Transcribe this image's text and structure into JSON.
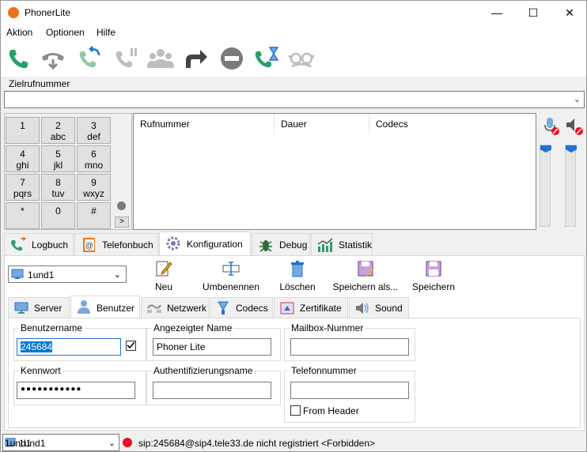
{
  "window": {
    "title": "PhonerLite",
    "minimize": "—",
    "maximize": "☐",
    "close": "✕"
  },
  "menu": [
    "Aktion",
    "Optionen",
    "Hilfe"
  ],
  "toolbar": {
    "icons": [
      "call-icon",
      "hangup-icon",
      "transfer-call-icon",
      "hold-icon",
      "conference-icon",
      "forward-icon",
      "do-not-disturb-icon",
      "call-waiting-icon",
      "incognito-icon"
    ]
  },
  "dial": {
    "label": "Zielrufnummer",
    "value": "",
    "dropdown_arrow": "⌄"
  },
  "keypad": {
    "keys": [
      {
        "digit": "1",
        "letters": ""
      },
      {
        "digit": "2",
        "letters": "abc"
      },
      {
        "digit": "3",
        "letters": "def"
      },
      {
        "digit": "4",
        "letters": "ghi"
      },
      {
        "digit": "5",
        "letters": "jkl"
      },
      {
        "digit": "6",
        "letters": "mno"
      },
      {
        "digit": "7",
        "letters": "pqrs"
      },
      {
        "digit": "8",
        "letters": "tuv"
      },
      {
        "digit": "9",
        "letters": "wxyz"
      },
      {
        "digit": "*",
        "letters": ""
      },
      {
        "digit": "0",
        "letters": ""
      },
      {
        "digit": "#",
        "letters": ""
      }
    ],
    "more": ">"
  },
  "calllist": {
    "columns": [
      "Rufnummer",
      "Dauer",
      "Codecs"
    ]
  },
  "tabs": [
    "Logbuch",
    "Telefonbuch",
    "Konfiguration",
    "Debug",
    "Statistik"
  ],
  "config": {
    "profile": "1und1",
    "profile_arrow": "⌄",
    "buttons": [
      "Neu",
      "Umbenennen",
      "Löschen",
      "Speichern als...",
      "Speichern"
    ]
  },
  "subtabs": [
    "Server",
    "Benutzer",
    "Netzwerk",
    "Codecs",
    "Zertifikate",
    "Sound"
  ],
  "user": {
    "username_label": "Benutzername",
    "username": "245684",
    "display_label": "Angezeigter Name",
    "display_name": "Phoner Lite",
    "mailbox_label": "Mailbox-Nummer",
    "mailbox": "",
    "password_label": "Kennwort",
    "password": "●●●●●●●●●●●",
    "auth_label": "Authentifizierungsname",
    "auth_name": "",
    "phone_label": "Telefonnummer",
    "phone": "",
    "from_header_label": "From Header"
  },
  "status": {
    "profile_small": "1und1",
    "profile": "1und1",
    "message": "sip:245684@sip4.tele33.de nicht registriert <Forbidden>",
    "dot_color": "#e81123"
  },
  "colors": {
    "green": "#2c9e6a",
    "blue": "#1e73d6",
    "gray": "#8c8c8c"
  }
}
